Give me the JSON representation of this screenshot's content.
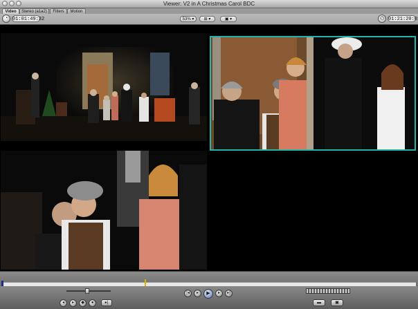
{
  "window": {
    "title": "Viewer: V2 in A Christmas Carol BDC"
  },
  "tabs": [
    {
      "label": "Video"
    },
    {
      "label": "Stereo (a1a2)"
    },
    {
      "label": "Filters"
    },
    {
      "label": "Motion"
    }
  ],
  "controls": {
    "duration": "01:01:49:32",
    "current": "01:21:20:01",
    "zoom": "53%",
    "overlay_icon": "overlay-icon",
    "view_icon": "view-options-icon"
  },
  "transport": {
    "icons": [
      "mark-in-icon",
      "play-in-to-out-icon",
      "play-around-icon",
      "mark-out-icon",
      "previous-edit-icon",
      "play-icon",
      "next-edit-icon",
      "match-frame-icon"
    ]
  },
  "colors": {
    "active_angle_border": "#24b4b0",
    "in_point": "#1c2d8c",
    "playhead": "#d6b400"
  }
}
